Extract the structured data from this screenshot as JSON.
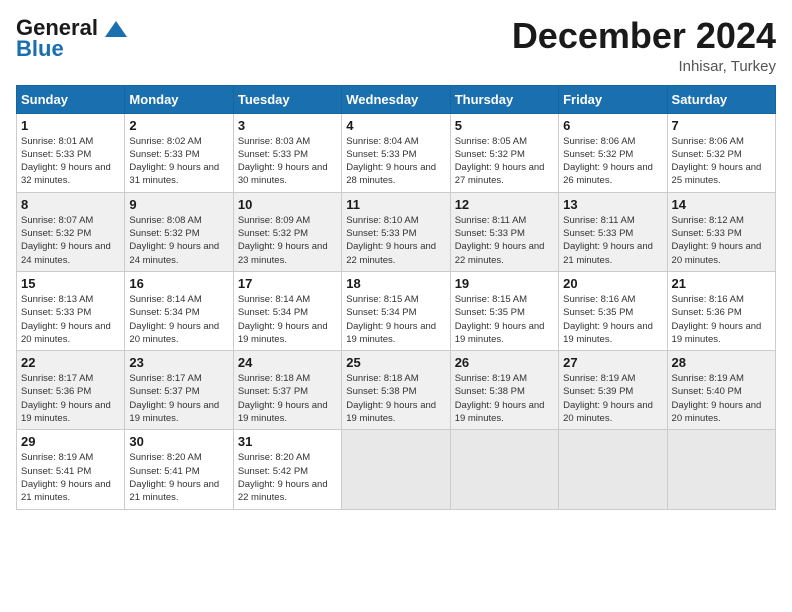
{
  "logo": {
    "general": "General",
    "blue": "Blue"
  },
  "header": {
    "month": "December 2024",
    "location": "Inhisar, Turkey"
  },
  "weekdays": [
    "Sunday",
    "Monday",
    "Tuesday",
    "Wednesday",
    "Thursday",
    "Friday",
    "Saturday"
  ],
  "weeks": [
    [
      {
        "day": "1",
        "sunrise": "Sunrise: 8:01 AM",
        "sunset": "Sunset: 5:33 PM",
        "daylight": "Daylight: 9 hours and 32 minutes."
      },
      {
        "day": "2",
        "sunrise": "Sunrise: 8:02 AM",
        "sunset": "Sunset: 5:33 PM",
        "daylight": "Daylight: 9 hours and 31 minutes."
      },
      {
        "day": "3",
        "sunrise": "Sunrise: 8:03 AM",
        "sunset": "Sunset: 5:33 PM",
        "daylight": "Daylight: 9 hours and 30 minutes."
      },
      {
        "day": "4",
        "sunrise": "Sunrise: 8:04 AM",
        "sunset": "Sunset: 5:33 PM",
        "daylight": "Daylight: 9 hours and 28 minutes."
      },
      {
        "day": "5",
        "sunrise": "Sunrise: 8:05 AM",
        "sunset": "Sunset: 5:32 PM",
        "daylight": "Daylight: 9 hours and 27 minutes."
      },
      {
        "day": "6",
        "sunrise": "Sunrise: 8:06 AM",
        "sunset": "Sunset: 5:32 PM",
        "daylight": "Daylight: 9 hours and 26 minutes."
      },
      {
        "day": "7",
        "sunrise": "Sunrise: 8:06 AM",
        "sunset": "Sunset: 5:32 PM",
        "daylight": "Daylight: 9 hours and 25 minutes."
      }
    ],
    [
      {
        "day": "8",
        "sunrise": "Sunrise: 8:07 AM",
        "sunset": "Sunset: 5:32 PM",
        "daylight": "Daylight: 9 hours and 24 minutes."
      },
      {
        "day": "9",
        "sunrise": "Sunrise: 8:08 AM",
        "sunset": "Sunset: 5:32 PM",
        "daylight": "Daylight: 9 hours and 24 minutes."
      },
      {
        "day": "10",
        "sunrise": "Sunrise: 8:09 AM",
        "sunset": "Sunset: 5:32 PM",
        "daylight": "Daylight: 9 hours and 23 minutes."
      },
      {
        "day": "11",
        "sunrise": "Sunrise: 8:10 AM",
        "sunset": "Sunset: 5:33 PM",
        "daylight": "Daylight: 9 hours and 22 minutes."
      },
      {
        "day": "12",
        "sunrise": "Sunrise: 8:11 AM",
        "sunset": "Sunset: 5:33 PM",
        "daylight": "Daylight: 9 hours and 22 minutes."
      },
      {
        "day": "13",
        "sunrise": "Sunrise: 8:11 AM",
        "sunset": "Sunset: 5:33 PM",
        "daylight": "Daylight: 9 hours and 21 minutes."
      },
      {
        "day": "14",
        "sunrise": "Sunrise: 8:12 AM",
        "sunset": "Sunset: 5:33 PM",
        "daylight": "Daylight: 9 hours and 20 minutes."
      }
    ],
    [
      {
        "day": "15",
        "sunrise": "Sunrise: 8:13 AM",
        "sunset": "Sunset: 5:33 PM",
        "daylight": "Daylight: 9 hours and 20 minutes."
      },
      {
        "day": "16",
        "sunrise": "Sunrise: 8:14 AM",
        "sunset": "Sunset: 5:34 PM",
        "daylight": "Daylight: 9 hours and 20 minutes."
      },
      {
        "day": "17",
        "sunrise": "Sunrise: 8:14 AM",
        "sunset": "Sunset: 5:34 PM",
        "daylight": "Daylight: 9 hours and 19 minutes."
      },
      {
        "day": "18",
        "sunrise": "Sunrise: 8:15 AM",
        "sunset": "Sunset: 5:34 PM",
        "daylight": "Daylight: 9 hours and 19 minutes."
      },
      {
        "day": "19",
        "sunrise": "Sunrise: 8:15 AM",
        "sunset": "Sunset: 5:35 PM",
        "daylight": "Daylight: 9 hours and 19 minutes."
      },
      {
        "day": "20",
        "sunrise": "Sunrise: 8:16 AM",
        "sunset": "Sunset: 5:35 PM",
        "daylight": "Daylight: 9 hours and 19 minutes."
      },
      {
        "day": "21",
        "sunrise": "Sunrise: 8:16 AM",
        "sunset": "Sunset: 5:36 PM",
        "daylight": "Daylight: 9 hours and 19 minutes."
      }
    ],
    [
      {
        "day": "22",
        "sunrise": "Sunrise: 8:17 AM",
        "sunset": "Sunset: 5:36 PM",
        "daylight": "Daylight: 9 hours and 19 minutes."
      },
      {
        "day": "23",
        "sunrise": "Sunrise: 8:17 AM",
        "sunset": "Sunset: 5:37 PM",
        "daylight": "Daylight: 9 hours and 19 minutes."
      },
      {
        "day": "24",
        "sunrise": "Sunrise: 8:18 AM",
        "sunset": "Sunset: 5:37 PM",
        "daylight": "Daylight: 9 hours and 19 minutes."
      },
      {
        "day": "25",
        "sunrise": "Sunrise: 8:18 AM",
        "sunset": "Sunset: 5:38 PM",
        "daylight": "Daylight: 9 hours and 19 minutes."
      },
      {
        "day": "26",
        "sunrise": "Sunrise: 8:19 AM",
        "sunset": "Sunset: 5:38 PM",
        "daylight": "Daylight: 9 hours and 19 minutes."
      },
      {
        "day": "27",
        "sunrise": "Sunrise: 8:19 AM",
        "sunset": "Sunset: 5:39 PM",
        "daylight": "Daylight: 9 hours and 20 minutes."
      },
      {
        "day": "28",
        "sunrise": "Sunrise: 8:19 AM",
        "sunset": "Sunset: 5:40 PM",
        "daylight": "Daylight: 9 hours and 20 minutes."
      }
    ],
    [
      {
        "day": "29",
        "sunrise": "Sunrise: 8:19 AM",
        "sunset": "Sunset: 5:41 PM",
        "daylight": "Daylight: 9 hours and 21 minutes."
      },
      {
        "day": "30",
        "sunrise": "Sunrise: 8:20 AM",
        "sunset": "Sunset: 5:41 PM",
        "daylight": "Daylight: 9 hours and 21 minutes."
      },
      {
        "day": "31",
        "sunrise": "Sunrise: 8:20 AM",
        "sunset": "Sunset: 5:42 PM",
        "daylight": "Daylight: 9 hours and 22 minutes."
      },
      null,
      null,
      null,
      null
    ]
  ]
}
